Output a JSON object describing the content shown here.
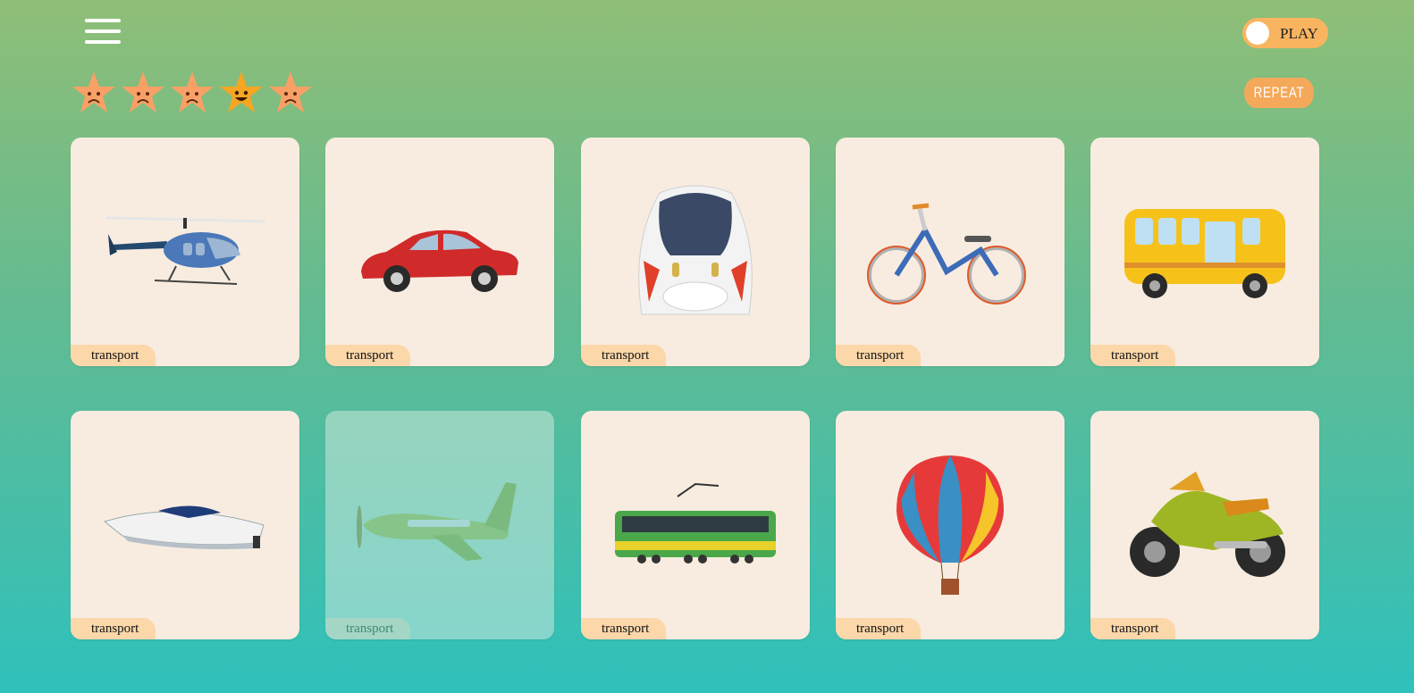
{
  "header": {
    "menu_icon": "hamburger-menu-icon",
    "play_toggle_label": "PLAY",
    "repeat_label": "REPEAT"
  },
  "score": {
    "stars_total": 5,
    "stars": [
      {
        "mood": "sad"
      },
      {
        "mood": "sad"
      },
      {
        "mood": "sad"
      },
      {
        "mood": "happy"
      },
      {
        "mood": "sad"
      }
    ]
  },
  "colors": {
    "card_bg": "#f8ece0",
    "tag_bg": "#fbd7aa",
    "star_sad": "#f9a066",
    "star_happy": "#f5a623",
    "accent": "#f4a95a"
  },
  "cards": [
    {
      "icon": "helicopter-icon",
      "label": "transport"
    },
    {
      "icon": "car-icon",
      "label": "transport"
    },
    {
      "icon": "bullet-train-icon",
      "label": "transport"
    },
    {
      "icon": "bicycle-icon",
      "label": "transport"
    },
    {
      "icon": "bus-icon",
      "label": "transport"
    },
    {
      "icon": "speedboat-icon",
      "label": "transport"
    },
    {
      "icon": "airplane-icon",
      "label": "transport",
      "state": "faded"
    },
    {
      "icon": "tram-icon",
      "label": "transport"
    },
    {
      "icon": "hot-air-balloon-icon",
      "label": "transport"
    },
    {
      "icon": "motorcycle-icon",
      "label": "transport"
    }
  ]
}
